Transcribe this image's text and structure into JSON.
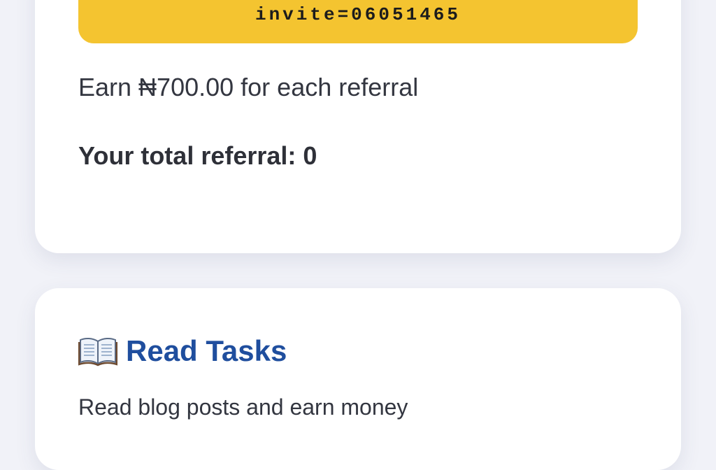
{
  "referral_card": {
    "invite_text": "invite=06051465",
    "earn_text": "Earn ₦700.00 for each referral",
    "total_text": "Your total referral: 0"
  },
  "read_tasks_card": {
    "title_icon": "open-book-icon",
    "title": "Read Tasks",
    "description": "Read blog posts and earn money"
  },
  "colors": {
    "background": "#f1f2f8",
    "banner": "#f4c430",
    "title_blue": "#1f4e9e"
  }
}
